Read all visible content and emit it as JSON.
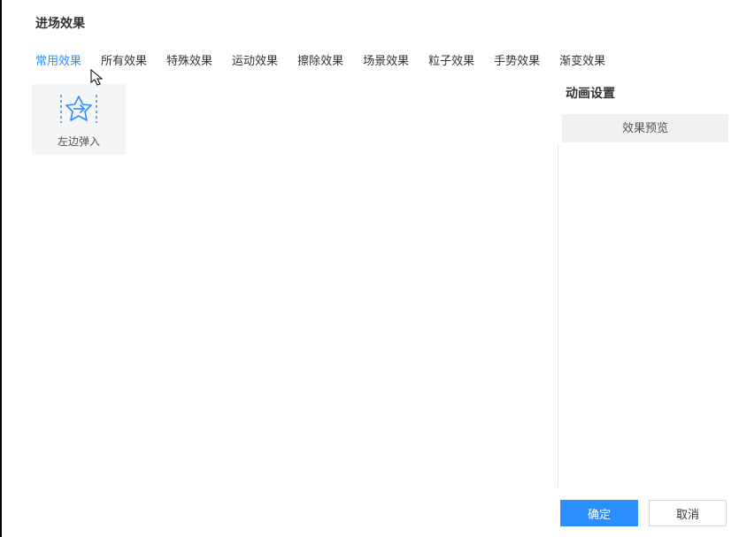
{
  "title": "进场效果",
  "tabs": [
    "常用效果",
    "所有效果",
    "特殊效果",
    "运动效果",
    "擦除效果",
    "场景效果",
    "粒子效果",
    "手势效果",
    "渐变效果"
  ],
  "active_tab_index": 0,
  "effects": [
    {
      "label": "左边弹入",
      "icon": "star-enter-left"
    }
  ],
  "side": {
    "title": "动画设置",
    "preview_label": "效果预览"
  },
  "footer": {
    "confirm": "确定",
    "cancel": "取消"
  }
}
